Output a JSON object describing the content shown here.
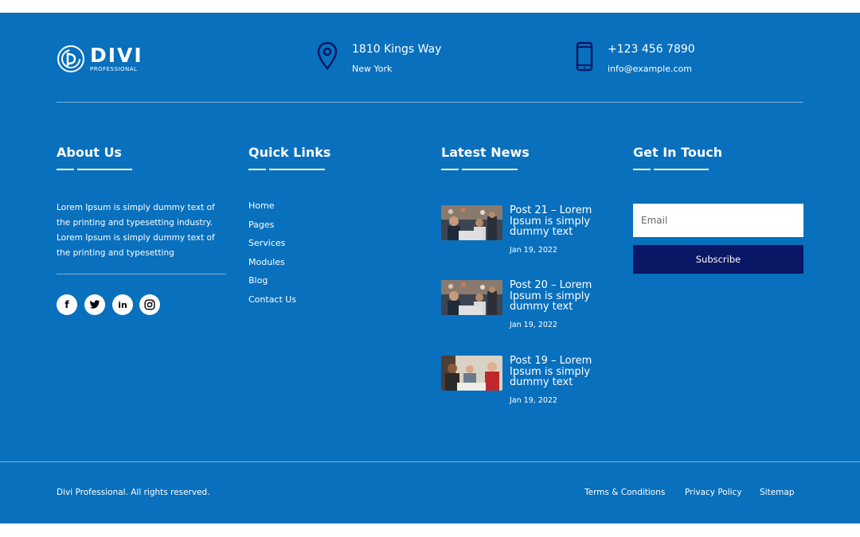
{
  "logo": {
    "name": "DIVI",
    "tagline": "PROFESSIONAL"
  },
  "contact": {
    "address_line1": "1810 Kings Way",
    "address_line2": "New York",
    "phone": "+123 456 7890",
    "email": "info@example.com"
  },
  "about": {
    "heading": "About Us",
    "text": "Lorem Ipsum is simply dummy text of the printing and typesetting industry. Lorem Ipsum is simply dummy text of the printing and typesetting"
  },
  "social_icons": [
    "facebook-icon",
    "twitter-icon",
    "linkedin-icon",
    "instagram-icon"
  ],
  "quick_links": {
    "heading": "Quick Links",
    "items": [
      "Home",
      "Pages",
      "Services",
      "Modules",
      "Blog",
      "Contact Us"
    ]
  },
  "latest_news": {
    "heading": "Latest News",
    "items": [
      {
        "title": "Post 21 – Lorem Ipsum is simply dummy text",
        "date": "Jan 19, 2022"
      },
      {
        "title": "Post 20 – Lorem Ipsum is simply dummy text",
        "date": "Jan 19, 2022"
      },
      {
        "title": "Post 19 – Lorem Ipsum is simply dummy text",
        "date": "Jan 19, 2022"
      }
    ]
  },
  "get_in_touch": {
    "heading": "Get In Touch",
    "email_placeholder": "Email",
    "subscribe_label": "Subscribe"
  },
  "bottom": {
    "copyright": "Divi Professional. All rights reserved.",
    "links": [
      "Terms & Conditions",
      "Privacy Policy",
      "Sitemap"
    ]
  },
  "colors": {
    "background": "#0870bd",
    "button": "#0a1764",
    "text": "#ffffff"
  }
}
